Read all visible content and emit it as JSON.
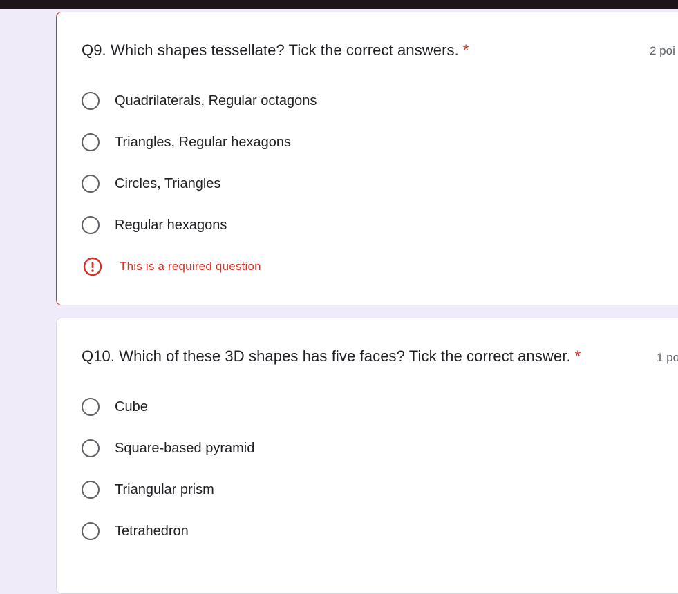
{
  "questions": [
    {
      "title": "Q9. Which shapes tessellate? Tick the correct answers.",
      "required_mark": "*",
      "points": "2 poi",
      "options": [
        "Quadrilaterals, Regular octagons",
        "Triangles, Regular hexagons",
        "Circles, Triangles",
        "Regular hexagons"
      ],
      "error": "This is a required question"
    },
    {
      "title": "Q10. Which of these 3D shapes has five faces? Tick the correct answer.",
      "required_mark": "*",
      "points": "1 po",
      "options": [
        "Cube",
        "Square-based pyramid",
        "Triangular prism",
        "Tetrahedron"
      ]
    }
  ],
  "colors": {
    "background": "#f0ebf8",
    "error": "#d93025",
    "text": "#202124",
    "muted": "#5f6368",
    "top_bar": "#1c1419"
  },
  "icons": {
    "radio": "radio-button-unchecked-icon",
    "error": "exclamation-circle-icon"
  }
}
